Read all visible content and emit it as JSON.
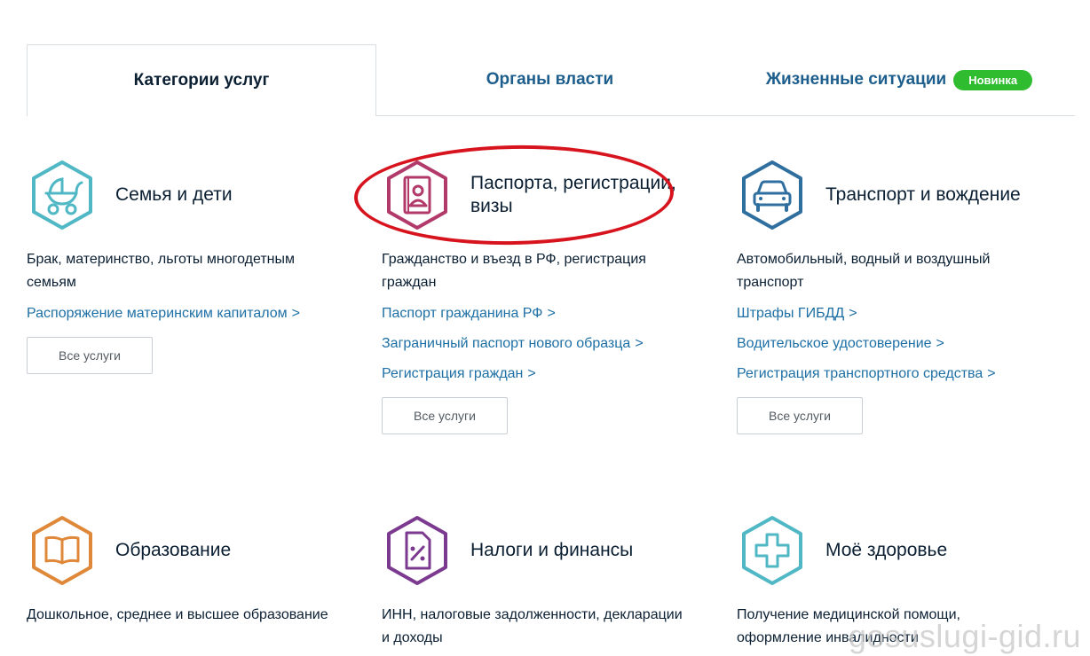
{
  "tabs": [
    {
      "label": "Категории услуг",
      "active": true
    },
    {
      "label": "Органы власти",
      "active": false
    },
    {
      "label": "Жизненные ситуации",
      "active": false,
      "badge": "Новинка"
    }
  ],
  "cards": [
    {
      "icon": "stroller-icon",
      "color": "#4fb8c4",
      "title": "Семья и дети",
      "description": "Брак, материнство, льготы многодетным семьям",
      "links": [
        "Распоряжение материнским капиталом"
      ],
      "button": "Все услуги"
    },
    {
      "icon": "passport-icon",
      "color": "#b23a6a",
      "title": "Паспорта, регистрации, визы",
      "description": "Гражданство и въезд в РФ, регистрация граждан",
      "links": [
        "Паспорт гражданина РФ",
        "Заграничный паспорт нового образца",
        "Регистрация граждан"
      ],
      "button": "Все услуги"
    },
    {
      "icon": "car-icon",
      "color": "#2f6fa0",
      "title": "Транспорт и вождение",
      "description": "Автомобильный, водный и воздушный транспорт",
      "links": [
        "Штрафы ГИБДД",
        "Водительское удостоверение",
        "Регистрация транспортного средства"
      ],
      "button": "Все услуги"
    },
    {
      "icon": "book-icon",
      "color": "#e0883a",
      "title": "Образование",
      "description": "Дошкольное, среднее и высшее образование"
    },
    {
      "icon": "tax-document-icon",
      "color": "#7b3a8f",
      "title": "Налоги и финансы",
      "description": "ИНН, налоговые задолженности, декларации и доходы"
    },
    {
      "icon": "medical-cross-icon",
      "color": "#4fb8c4",
      "title": "Моё здоровье",
      "description": "Получение медицинской помощи, оформление инвалидности"
    }
  ],
  "link_chevron": ">",
  "watermark": "gosuslugi-gid.ru"
}
